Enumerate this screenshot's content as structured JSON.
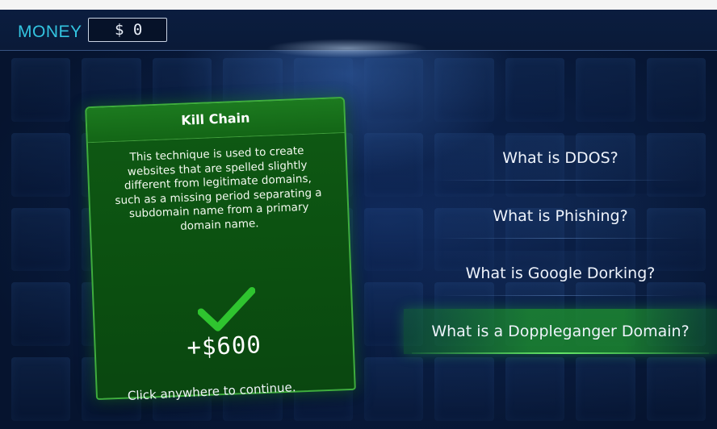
{
  "header": {
    "money_label": "MONEY",
    "money_value": "$ 0"
  },
  "card": {
    "title": "Kill Chain",
    "text": "This technique is used to create websites that are spelled slightly different from legitimate domains, such as a missing period separating a subdomain name from a primary domain name.",
    "result_icon": "check-icon",
    "reward": "+$600"
  },
  "answers": [
    {
      "label": "What is DDOS?",
      "selected": false
    },
    {
      "label": "What is Phishing?",
      "selected": false
    },
    {
      "label": "What is Google Dorking?",
      "selected": false
    },
    {
      "label": "What is a Doppleganger Domain?",
      "selected": true
    }
  ],
  "footer": {
    "continue_text": "Click anywhere to continue."
  },
  "colors": {
    "money_label": "#33c4e0",
    "card_green": "#0f5a14",
    "card_border": "#3fae3c",
    "check_green": "#2fc42f",
    "selected_answer": "#1e962d",
    "background": "#0a1e44"
  }
}
